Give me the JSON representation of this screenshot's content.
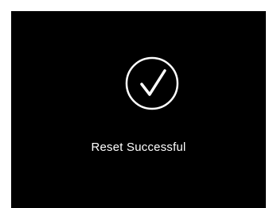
{
  "dialog": {
    "icon": "checkmark-circle-icon",
    "message": "Reset Successful",
    "background_color": "#000000",
    "foreground_color": "#ffffff"
  }
}
